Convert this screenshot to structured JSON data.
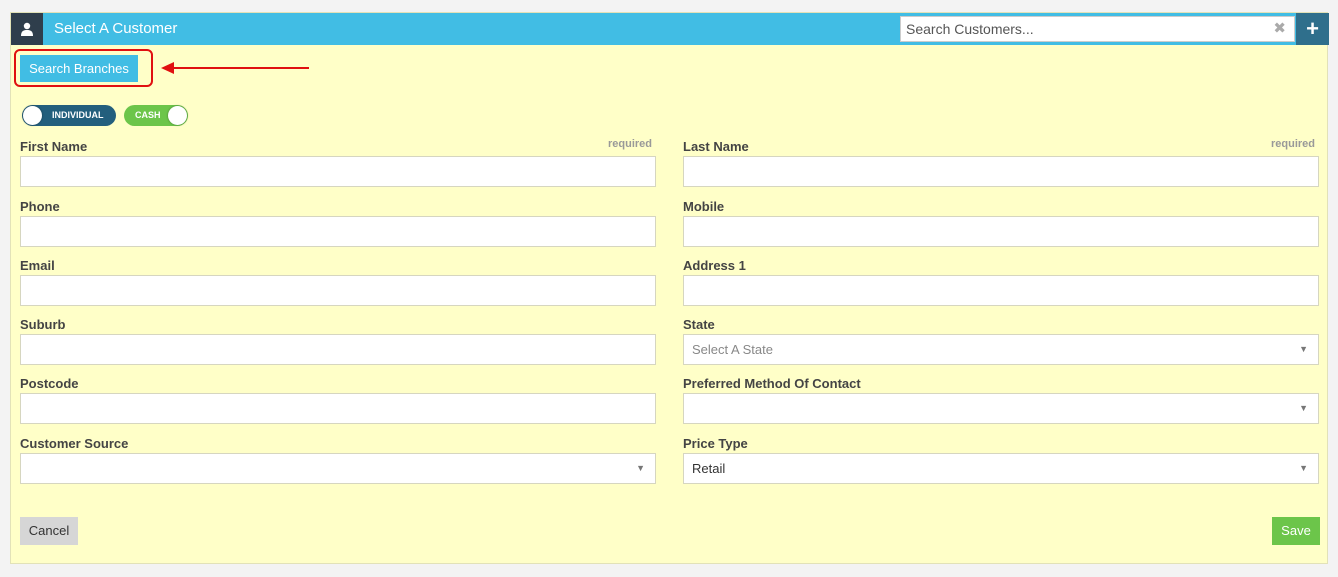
{
  "header": {
    "title": "Select A Customer",
    "search_placeholder": "Search Customers...",
    "clear_glyph": "✖",
    "add_glyph": "+",
    "color": "#41bde4"
  },
  "toolbar": {
    "search_branches_label": "Search Branches"
  },
  "toggles": {
    "individual_label": "INDIVIDUAL",
    "cash_label": "CASH"
  },
  "form": {
    "required_text": "required",
    "first_name_label": "First Name",
    "last_name_label": "Last Name",
    "phone_label": "Phone",
    "mobile_label": "Mobile",
    "email_label": "Email",
    "address1_label": "Address 1",
    "suburb_label": "Suburb",
    "state_label": "State",
    "state_placeholder": "Select A State",
    "postcode_label": "Postcode",
    "preferred_contact_label": "Preferred Method Of Contact",
    "customer_source_label": "Customer Source",
    "price_type_label": "Price Type",
    "price_type_value": "Retail",
    "caret_glyph": "▼"
  },
  "actions": {
    "cancel_label": "Cancel",
    "save_label": "Save"
  },
  "icons": {
    "user": "user-icon",
    "clear": "clear-icon",
    "add": "plus-icon",
    "arrow": "annotation-arrow-icon"
  }
}
